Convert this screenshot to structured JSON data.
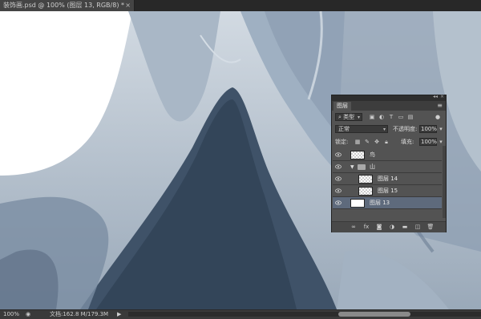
{
  "document_tab": {
    "title": "装饰画.psd @ 100% (图层 13, RGB/8) *",
    "close_glyph": "×"
  },
  "status_bar": {
    "zoom": "100%",
    "doc_info": "文档:162.8 M/179.3M"
  },
  "layers_panel": {
    "tab_label": "图层",
    "filter_kind": "类型",
    "blend_mode": "正常",
    "opacity_label": "不透明度:",
    "opacity_value": "100%",
    "lock_label": "锁定:",
    "fill_label": "填充:",
    "fill_value": "100%",
    "layers": [
      {
        "name": "鸟",
        "type": "layer",
        "indent": 0,
        "selected": false,
        "thumb": "transparent"
      },
      {
        "name": "山",
        "type": "group",
        "indent": 0,
        "selected": false,
        "thumb": "folder"
      },
      {
        "name": "图层 14",
        "type": "layer",
        "indent": 1,
        "selected": false,
        "thumb": "transparent"
      },
      {
        "name": "图层 15",
        "type": "layer",
        "indent": 1,
        "selected": false,
        "thumb": "transparent"
      },
      {
        "name": "图层 13",
        "type": "layer",
        "indent": 0,
        "selected": true,
        "thumb": "white"
      }
    ],
    "bottom_icons": [
      "link-icon",
      "fx-icon",
      "mask-icon",
      "adjustment-icon",
      "folder-icon",
      "new-layer-icon",
      "trash-icon"
    ],
    "fx_label": "fx"
  },
  "colors": {
    "selected_layer": "#5e6a7c",
    "canvas_dark": "#3f5268",
    "canvas_light": "#c2ccd6"
  }
}
